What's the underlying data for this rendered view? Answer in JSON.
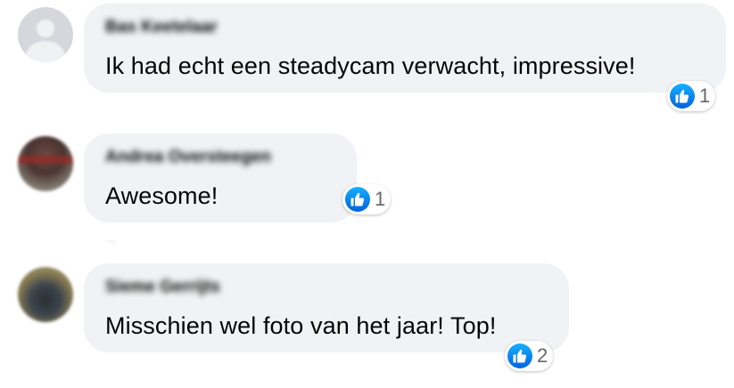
{
  "comments": [
    {
      "author": "Bas Keetelaar",
      "text": "Ik had echt een steadycam verwacht, impressive!",
      "likes": "1"
    },
    {
      "author": "Andrea Oversteegen",
      "text": "Awesome!",
      "likes": "1"
    },
    {
      "author": "Sieme Gerrijts",
      "text": "Misschien wel foto van het jaar! Top!",
      "likes": "2"
    }
  ],
  "colors": {
    "bubble": "#f0f2f5",
    "like_blue": "#1877f2",
    "count_gray": "#65676b"
  },
  "icons": {
    "reaction": "thumbs-up-icon",
    "avatar_default": "default-user-avatar"
  }
}
